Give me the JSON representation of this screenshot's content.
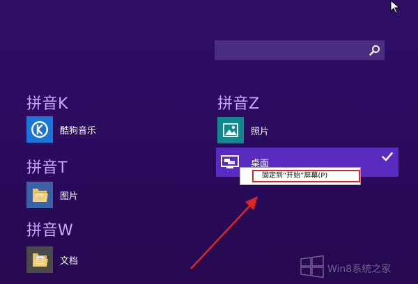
{
  "search": {
    "value": "",
    "placeholder": ""
  },
  "groups": [
    {
      "header": "拼音K",
      "apps": [
        {
          "label": "酷狗音乐",
          "icon": "kugou-music-icon",
          "color": "#1a73d9"
        }
      ]
    },
    {
      "header": "拼音T",
      "apps": [
        {
          "label": "图片",
          "icon": "pictures-folder-icon",
          "color": "#f1c24c"
        }
      ]
    },
    {
      "header": "拼音W",
      "apps": [
        {
          "label": "文档",
          "icon": "documents-folder-icon",
          "color": "#e9c361"
        }
      ]
    },
    {
      "header": "拼音Z",
      "apps": [
        {
          "label": "照片",
          "icon": "photos-icon",
          "color": "#0f8a8f"
        },
        {
          "label": "桌面",
          "icon": "desktop-icon",
          "color": "#5a2bc1",
          "selected": true
        }
      ]
    }
  ],
  "context_menu": {
    "items": [
      {
        "label": "固定到“开始”屏幕(P)"
      }
    ]
  },
  "watermark": {
    "text": "Win8系统之家"
  },
  "colors": {
    "background": "#2b0c5e",
    "header": "#c9a8ff",
    "selected": "#5a2bc1",
    "highlight": "#e02424"
  }
}
